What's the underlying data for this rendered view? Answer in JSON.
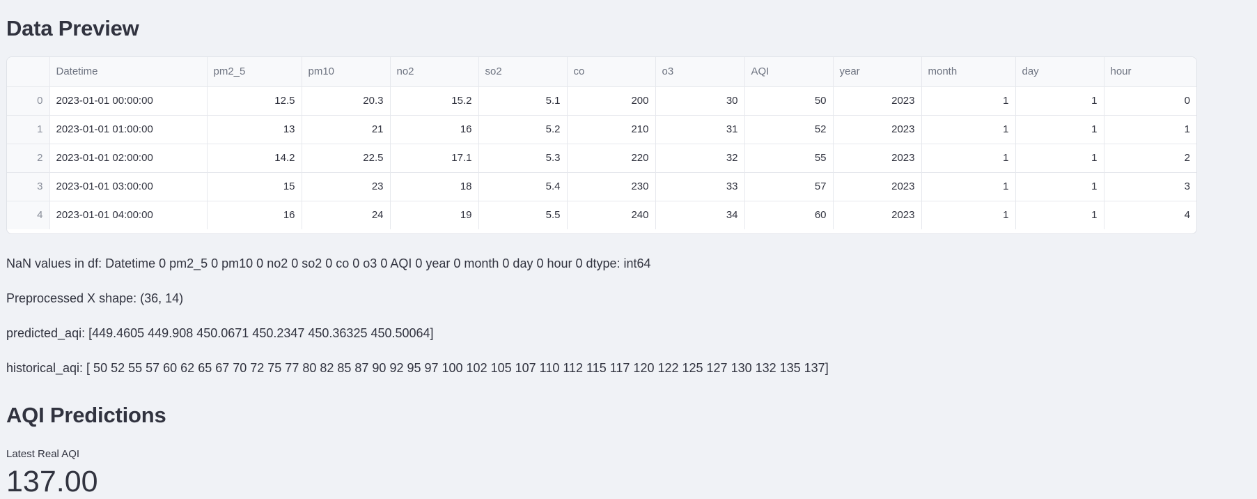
{
  "data_preview": {
    "title": "Data Preview",
    "columns": [
      "",
      "Datetime",
      "pm2_5",
      "pm10",
      "no2",
      "so2",
      "co",
      "o3",
      "AQI",
      "year",
      "month",
      "day",
      "hour"
    ],
    "rows": [
      [
        "0",
        "2023-01-01 00:00:00",
        "12.5",
        "20.3",
        "15.2",
        "5.1",
        "200",
        "30",
        "50",
        "2023",
        "1",
        "1",
        "0"
      ],
      [
        "1",
        "2023-01-01 01:00:00",
        "13",
        "21",
        "16",
        "5.2",
        "210",
        "31",
        "52",
        "2023",
        "1",
        "1",
        "1"
      ],
      [
        "2",
        "2023-01-01 02:00:00",
        "14.2",
        "22.5",
        "17.1",
        "5.3",
        "220",
        "32",
        "55",
        "2023",
        "1",
        "1",
        "2"
      ],
      [
        "3",
        "2023-01-01 03:00:00",
        "15",
        "23",
        "18",
        "5.4",
        "230",
        "33",
        "57",
        "2023",
        "1",
        "1",
        "3"
      ],
      [
        "4",
        "2023-01-01 04:00:00",
        "16",
        "24",
        "19",
        "5.5",
        "240",
        "34",
        "60",
        "2023",
        "1",
        "1",
        "4"
      ]
    ]
  },
  "log_lines": {
    "nan": "NaN values in df: Datetime 0 pm2_5 0 pm10 0 no2 0 so2 0 co 0 o3 0 AQI 0 year 0 month 0 day 0 hour 0 dtype: int64",
    "shape": "Preprocessed X shape: (36, 14)",
    "predicted": "predicted_aqi: [449.4605 449.908 450.0671 450.2347 450.36325 450.50064]",
    "historical": "historical_aqi: [ 50 52 55 57 60 62 65 67 70 72 75 77 80 82 85 87 90 92 95 97 100 102 105 107 110 112 115 117 120 122 125 127 130 132 135 137]"
  },
  "aqi_predictions": {
    "title": "AQI Predictions",
    "metric_label": "Latest Real AQI",
    "metric_value": "137.00"
  }
}
